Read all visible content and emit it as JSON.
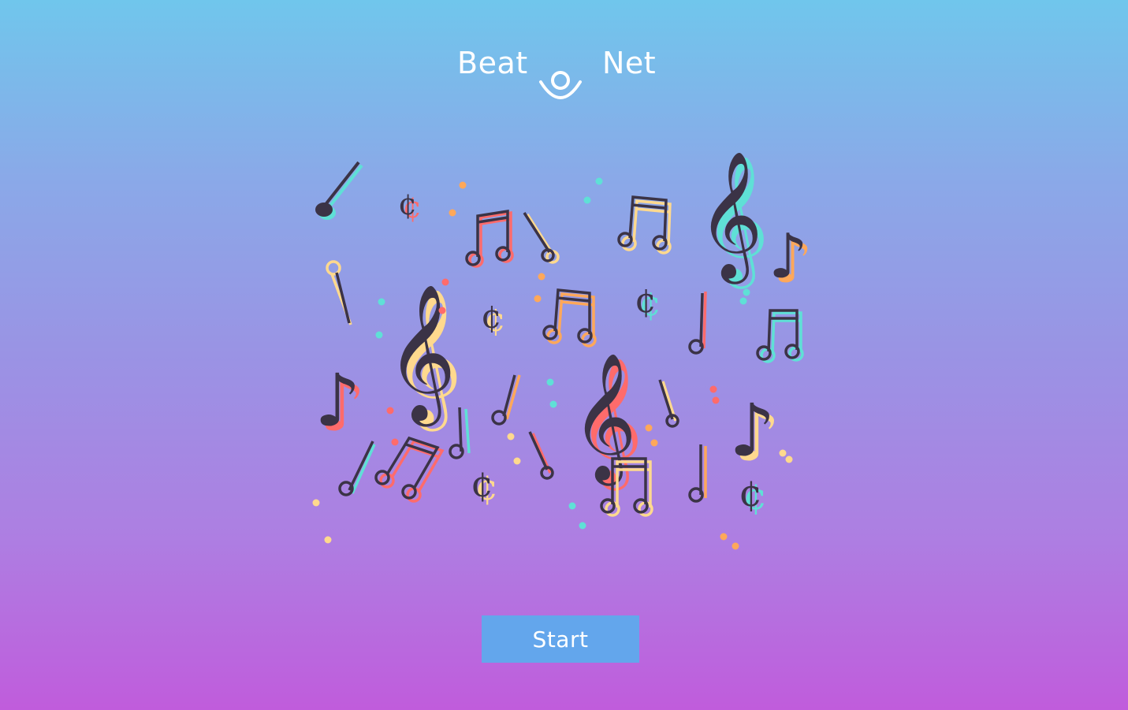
{
  "app": {
    "logo_left": "Beat",
    "logo_right": "Net",
    "logo_icon": "smiley-mark-icon"
  },
  "illustration": {
    "icon": "music-notes-illustration"
  },
  "actions": {
    "start_label": "Start"
  },
  "colors": {
    "background_top": "#70c6ec",
    "background_bottom": "#c05cdc",
    "button": "#63a6ec",
    "ink": "#3b3346",
    "accent_teal": "#5fe0d6",
    "accent_red": "#ff6b6b",
    "accent_orange": "#ffa85a",
    "accent_yellow": "#ffd98e"
  }
}
